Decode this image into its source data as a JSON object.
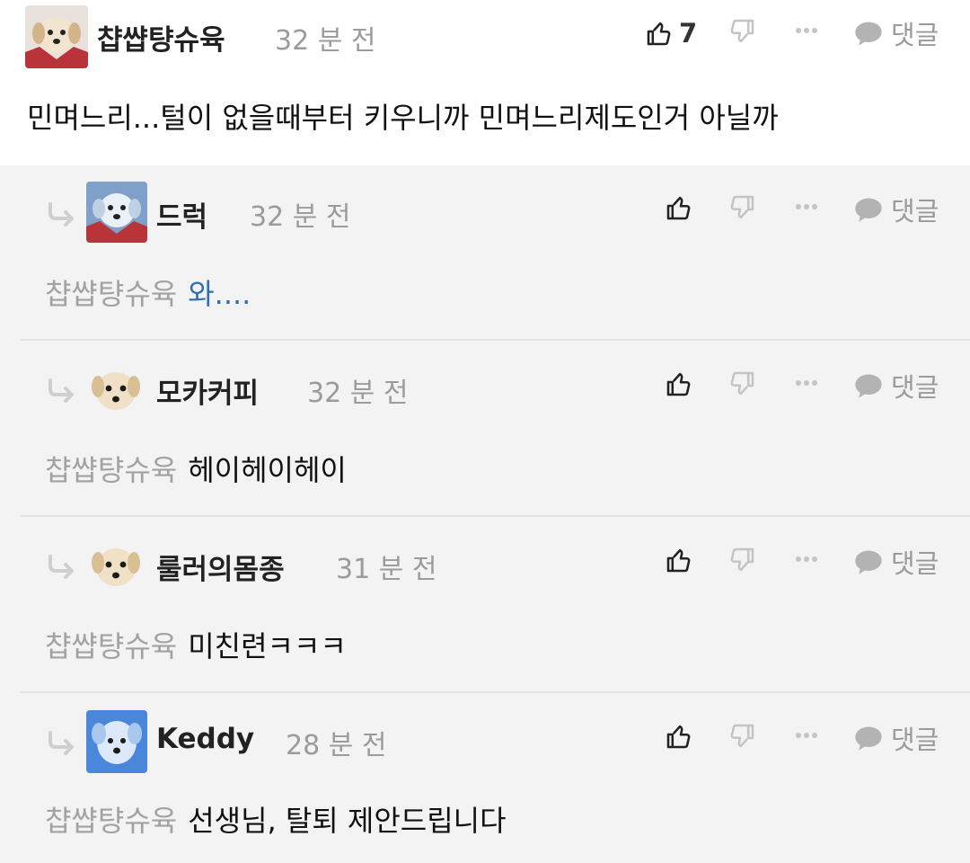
{
  "comments": [
    {
      "username": "챱썁턍슈육",
      "time": "32 분 전",
      "like_count": "7",
      "reply_label": "댓글",
      "text": "민며느리...털이 없을때부터 키우니까 민며느리제도인거 아닐까"
    },
    {
      "username": "드럭",
      "time": "32 분 전",
      "reply_label": "댓글",
      "mention": "챱썁턍슈육",
      "text": "와...."
    },
    {
      "username": "모카커피",
      "time": "32 분 전",
      "reply_label": "댓글",
      "mention": "챱썁턍슈육",
      "text": "헤이헤이헤이"
    },
    {
      "username": "룰러의몸종",
      "time": "31 분 전",
      "reply_label": "댓글",
      "mention": "챱썁턍슈육",
      "text": "미친련ㅋㅋㅋ"
    },
    {
      "username": "Keddy",
      "time": "28 분 전",
      "reply_label": "댓글",
      "mention": "챱썁턍슈육",
      "text": "선생님, 탈퇴 제안드립니다"
    }
  ],
  "icons": {
    "like": "thumbs-up-icon",
    "dislike": "thumbs-down-icon",
    "more": "more-dots-icon",
    "reply": "speech-bubble-icon",
    "reply_indicator": "reply-arrow-icon"
  },
  "colors": {
    "link": "#2f6fb3",
    "muted": "#9b9b9b",
    "reply_background": "#f3f3f3"
  }
}
